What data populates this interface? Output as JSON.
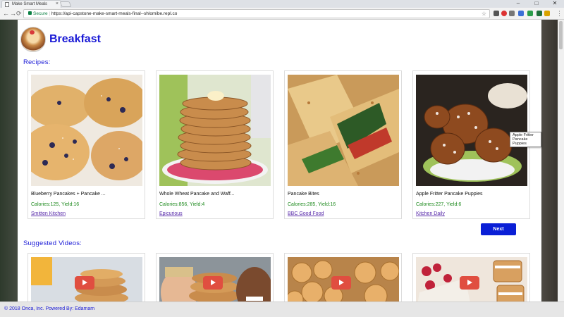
{
  "browser": {
    "tab_title": "Make Smart Meals",
    "tab_close": "×",
    "secure_label": "Secure",
    "url": "https://api-capstone-make-smart-meals-final--shlomibe.repl.co",
    "window_controls": {
      "minimize": "–",
      "maximize": "□",
      "close": "✕"
    },
    "nav": {
      "back": "←",
      "forward": "→",
      "reload": "⟳"
    },
    "star": "☆",
    "menu": "⋮"
  },
  "page": {
    "title": "Breakfast",
    "recipes_heading": "Recipes:",
    "videos_heading": "Suggested Videos:",
    "next_label": "Next",
    "tooltip": "Apple Fritter Pancake Puppies"
  },
  "recipes": [
    {
      "title": "Blueberry Pancakes + Pancake ...",
      "meta": "Calories:125, Yield:16",
      "source": "Smitten Kitchen"
    },
    {
      "title": "Whole Wheat Pancake and Waff...",
      "meta": "Calories:856, Yield:4",
      "source": "Epicurious"
    },
    {
      "title": "Pancake Bites",
      "meta": "Calories:285, Yield:16",
      "source": "BBC Good Food"
    },
    {
      "title": "Apple Fritter Pancake Puppies",
      "meta": "Calories:227, Yield:6",
      "source": "Kitchen Daily"
    }
  ],
  "footer": {
    "text": "© 2018 Onca, Inc. Powered By: Edamam"
  },
  "colors": {
    "accent": "#1a1ad6",
    "button": "#0a1fd6",
    "meta_green": "#1e8a1e",
    "play_red": "#e04e40"
  }
}
